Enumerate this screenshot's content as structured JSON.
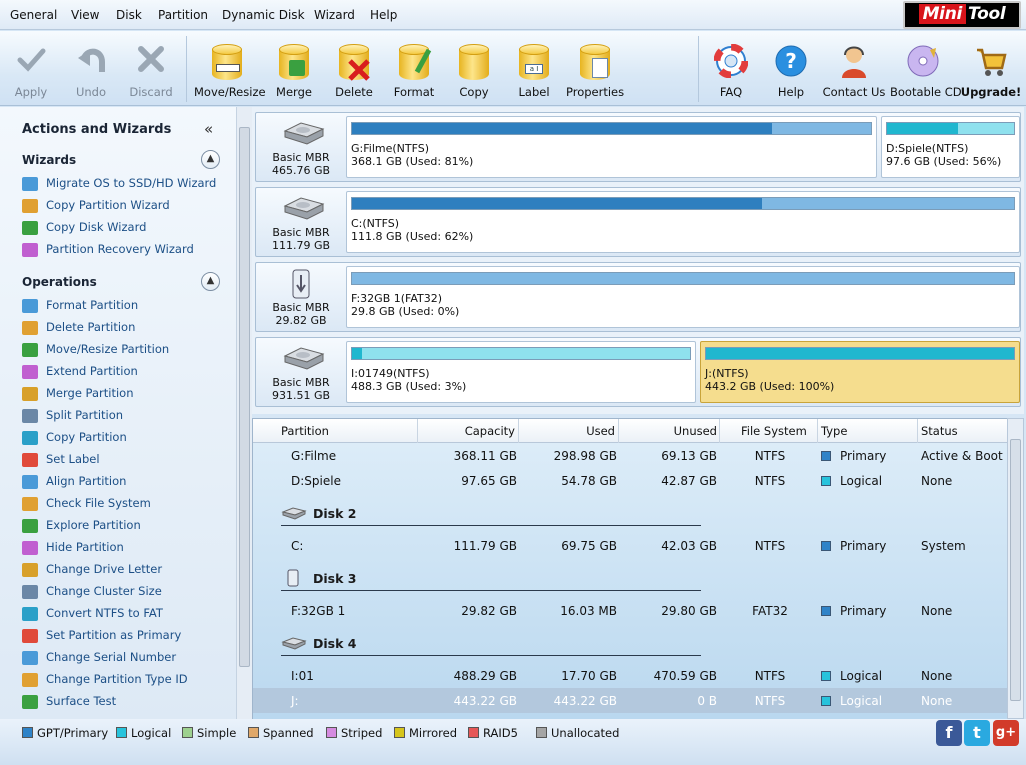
{
  "menu": {
    "items": [
      "General",
      "View",
      "Disk",
      "Partition",
      "Dynamic Disk",
      "Wizard",
      "Help"
    ]
  },
  "brand": {
    "logo_word1": "Mini",
    "logo_word2": "Tool"
  },
  "toolbar": {
    "apply": "Apply",
    "undo": "Undo",
    "discard": "Discard",
    "move_resize": "Move/Resize",
    "merge": "Merge",
    "delete": "Delete",
    "format": "Format",
    "copy": "Copy",
    "label": "Label",
    "properties": "Properties",
    "faq": "FAQ",
    "help": "Help",
    "contact": "Contact Us",
    "bootable": "Bootable CD",
    "upgrade": "Upgrade!"
  },
  "left_panel": {
    "title": "Actions and Wizards",
    "wizards_heading": "Wizards",
    "wizards": [
      "Migrate OS to SSD/HD Wizard",
      "Copy Partition Wizard",
      "Copy Disk Wizard",
      "Partition Recovery Wizard"
    ],
    "operations_heading": "Operations",
    "operations": [
      "Format Partition",
      "Delete Partition",
      "Move/Resize Partition",
      "Extend Partition",
      "Merge Partition",
      "Split Partition",
      "Copy Partition",
      "Set Label",
      "Align Partition",
      "Check File System",
      "Explore Partition",
      "Hide Partition",
      "Change Drive Letter",
      "Change Cluster Size",
      "Convert NTFS to FAT",
      "Set Partition as Primary",
      "Change Serial Number",
      "Change Partition Type ID",
      "Surface Test"
    ]
  },
  "disks": [
    {
      "type": "Basic MBR",
      "size": "465.76 GB",
      "partitions": [
        {
          "name": "G:Filme(NTFS)",
          "info": "368.1 GB (Used: 81%)",
          "used": 0.81,
          "kind": "primary"
        },
        {
          "name": "D:Spiele(NTFS)",
          "info": "97.6 GB (Used: 56%)",
          "used": 0.56,
          "kind": "logical"
        }
      ]
    },
    {
      "type": "Basic MBR",
      "size": "111.79 GB",
      "partitions": [
        {
          "name": "C:(NTFS)",
          "info": "111.8 GB (Used: 62%)",
          "used": 0.62,
          "kind": "primary"
        }
      ]
    },
    {
      "type": "Basic MBR",
      "size": "29.82 GB",
      "partitions": [
        {
          "name": "F:32GB 1(FAT32)",
          "info": "29.8 GB (Used: 0%)",
          "used": 0.0,
          "kind": "primary"
        }
      ]
    },
    {
      "type": "Basic MBR",
      "size": "931.51 GB",
      "partitions": [
        {
          "name": "I:01749(NTFS)",
          "info": "488.3 GB (Used: 3%)",
          "used": 0.03,
          "kind": "logical"
        },
        {
          "name": "J:(NTFS)",
          "info": "443.2 GB (Used: 100%)",
          "used": 1.0,
          "kind": "logical"
        }
      ]
    }
  ],
  "table": {
    "headers": [
      "Partition",
      "Capacity",
      "Used",
      "Unused",
      "File System",
      "Type",
      "Status"
    ],
    "groups": [
      {
        "disk": "",
        "rows": [
          [
            "G:Filme",
            "368.11 GB",
            "298.98 GB",
            "69.13 GB",
            "NTFS",
            "Primary",
            "Active & Boot"
          ],
          [
            "D:Spiele",
            "97.65 GB",
            "54.78 GB",
            "42.87 GB",
            "NTFS",
            "Logical",
            "None"
          ]
        ]
      },
      {
        "disk": "Disk 2",
        "rows": [
          [
            "C:",
            "111.79 GB",
            "69.75 GB",
            "42.03 GB",
            "NTFS",
            "Primary",
            "System"
          ]
        ]
      },
      {
        "disk": "Disk 3",
        "rows": [
          [
            "F:32GB 1",
            "29.82 GB",
            "16.03 MB",
            "29.80 GB",
            "FAT32",
            "Primary",
            "None"
          ]
        ]
      },
      {
        "disk": "Disk 4",
        "rows": [
          [
            "I:01",
            "488.29 GB",
            "17.70 GB",
            "470.59 GB",
            "NTFS",
            "Logical",
            "None"
          ],
          [
            "J:",
            "443.22 GB",
            "443.22 GB",
            "0 B",
            "NTFS",
            "Logical",
            "None"
          ]
        ]
      }
    ]
  },
  "legend": [
    "GPT/Primary",
    "Logical",
    "Simple",
    "Spanned",
    "Striped",
    "Mirrored",
    "RAID5",
    "Unallocated"
  ],
  "colors": {
    "primary": "#2f83c8",
    "logical": "#27c3dc",
    "simple": "#9ed18f",
    "spanned": "#e0a86a",
    "striped": "#d58be0",
    "mirrored": "#d6c51b",
    "raid5": "#e55757",
    "unallocated": "#a5a5a5",
    "selected_partition": "#f5dd8e"
  }
}
